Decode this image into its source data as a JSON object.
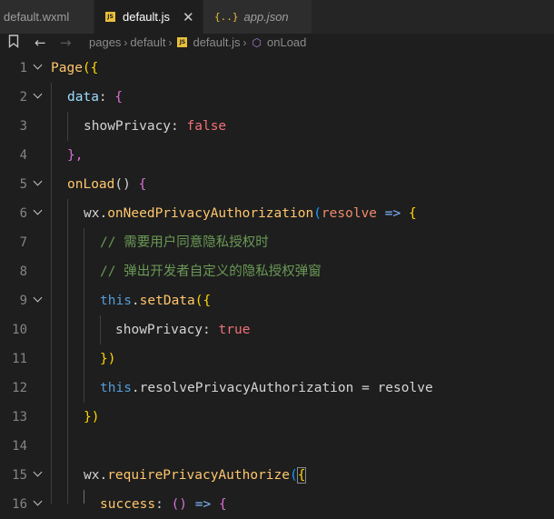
{
  "tabs": [
    {
      "label": "default.wxml"
    },
    {
      "label": "default.js",
      "close": "✕"
    },
    {
      "label": "app.json",
      "icon_text": "{..}"
    }
  ],
  "breadcrumb": {
    "items": [
      "pages",
      "default",
      "default.js",
      "onLoad"
    ],
    "separator": "›"
  },
  "editor": {
    "line_numbers": [
      "1",
      "2",
      "3",
      "4",
      "5",
      "6",
      "7",
      "8",
      "9",
      "10",
      "11",
      "12",
      "13",
      "14",
      "15",
      "16"
    ],
    "lines": [
      {
        "t": [
          "Page",
          "({"
        ]
      },
      {
        "t": [
          "data",
          ": ",
          "{"
        ]
      },
      {
        "t": [
          "showPrivacy",
          ": ",
          "false"
        ]
      },
      {
        "t": [
          "},"
        ]
      },
      {
        "t": [
          "onLoad",
          "() ",
          "{"
        ]
      },
      {
        "t": [
          "wx",
          ".",
          "onNeedPrivacyAuthorization",
          "(",
          "resolve",
          " => ",
          "{"
        ]
      },
      {
        "t": [
          "// 需要用户同意隐私授权时"
        ]
      },
      {
        "t": [
          "// 弹出开发者自定义的隐私授权弹窗"
        ]
      },
      {
        "t": [
          "this",
          ".",
          "setData",
          "({"
        ]
      },
      {
        "t": [
          "showPrivacy",
          ": ",
          "true"
        ]
      },
      {
        "t": [
          "})"
        ]
      },
      {
        "t": [
          "this",
          ".",
          "resolvePrivacyAuthorization",
          " = ",
          "resolve"
        ]
      },
      {
        "t": [
          "})"
        ]
      },
      {
        "t": [
          ""
        ]
      },
      {
        "t": [
          "wx",
          ".",
          "requirePrivacyAuthorize",
          "(",
          "{"
        ]
      },
      {
        "t": [
          "success",
          ": ",
          "()",
          " => ",
          "{"
        ]
      }
    ]
  },
  "icons": {
    "js_badge": "JS",
    "bookmark": "bookmark-icon",
    "back": "←",
    "forward": "→",
    "symbol_method": "⬡"
  },
  "colors": {
    "background": "#1e1e1e",
    "keyword": "#569cd6",
    "function": "#ffc66d",
    "comment": "#6a9955",
    "boolean": "#f07178"
  }
}
